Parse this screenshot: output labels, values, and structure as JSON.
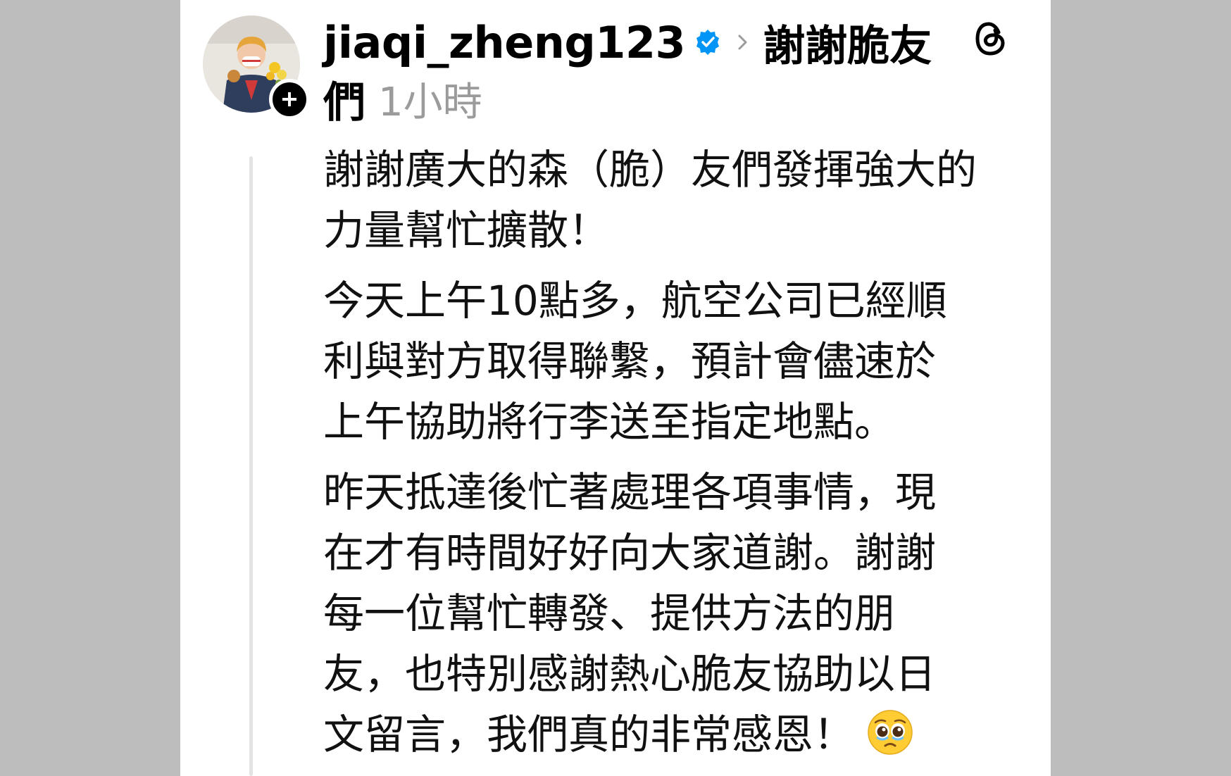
{
  "post": {
    "username": "jiaqi_zheng123",
    "topic_part1": "謝謝脆友",
    "topic_part2": "們",
    "timestamp": "1小時",
    "paragraphs": [
      [
        "謝謝廣大的森（脆）友們發揮強大的",
        "力量幫忙擴散！"
      ],
      [
        "今天上午10點多，航空公司已經順",
        "利與對方取得聯繫，預計會儘速於",
        "上午協助將行李送至指定地點。"
      ],
      [
        "昨天抵達後忙著處理各項事情，現",
        "在才有時間好好向大家道謝。謝謝",
        "每一位幫忙轉發、提供方法的朋",
        "友，也特別感謝熱心脆友協助以日",
        "文留言，我們真的非常感恩！"
      ]
    ]
  },
  "icons": {
    "verified": "verified-badge-icon",
    "chevron": "chevron-right-icon",
    "threads": "threads-logo-icon",
    "follow": "plus-icon",
    "emoji": "pleading-face-emoji"
  },
  "colors": {
    "background": "#bdbdbd",
    "card": "#ffffff",
    "verified_blue": "#0095f6",
    "timestamp_gray": "#9b9b9b",
    "thread_line": "#e3e3e3"
  }
}
